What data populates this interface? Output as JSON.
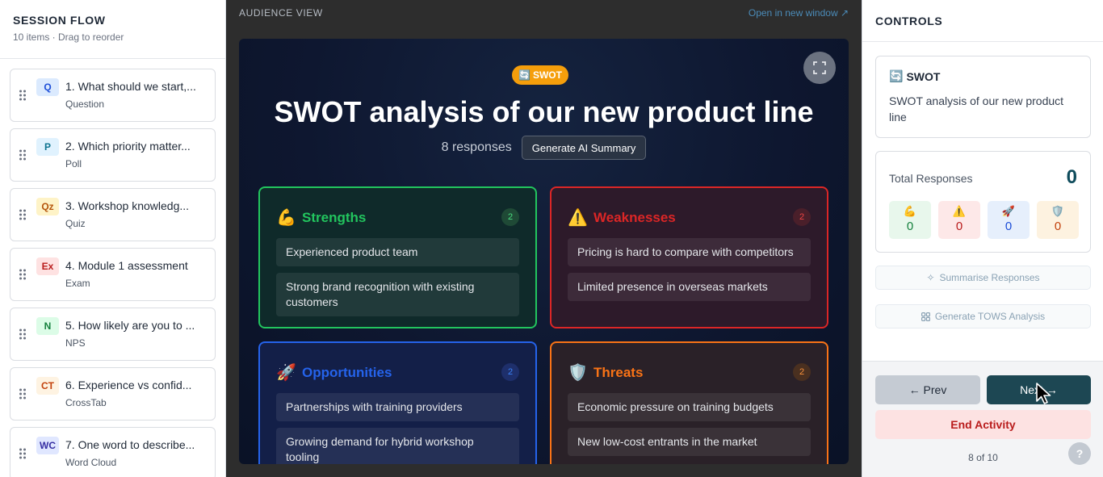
{
  "left": {
    "title": "SESSION FLOW",
    "subtitle": "10 items · Drag to reorder",
    "items": [
      {
        "badge": "Q",
        "title": "1. What should we start,...",
        "type": "Question",
        "badge_bg": "#dbeafe",
        "badge_fg": "#1d4ed8"
      },
      {
        "badge": "P",
        "title": "2. Which priority matter...",
        "type": "Poll",
        "badge_bg": "#e0f2fe",
        "badge_fg": "#0e7490"
      },
      {
        "badge": "Qz",
        "title": "3. Workshop knowledg...",
        "type": "Quiz",
        "badge_bg": "#fef3c7",
        "badge_fg": "#b45309"
      },
      {
        "badge": "Ex",
        "title": "4. Module 1 assessment",
        "type": "Exam",
        "badge_bg": "#fee2e2",
        "badge_fg": "#b91c1c"
      },
      {
        "badge": "N",
        "title": "5. How likely are you to ...",
        "type": "NPS",
        "badge_bg": "#dcfce7",
        "badge_fg": "#15803d"
      },
      {
        "badge": "CT",
        "title": "6. Experience vs confid...",
        "type": "CrossTab",
        "badge_bg": "#fef3e2",
        "badge_fg": "#c2410c"
      },
      {
        "badge": "WC",
        "title": "7. One word to describe...",
        "type": "Word Cloud",
        "badge_bg": "#e0e7ff",
        "badge_fg": "#3730a3"
      }
    ]
  },
  "center": {
    "label": "AUDIENCE VIEW",
    "open_link": "Open in new window ↗",
    "pill": "SWOT",
    "title": "SWOT analysis of our new product line",
    "responses": "8 responses",
    "ai_button": "Generate AI Summary",
    "quadrants": {
      "strengths": {
        "label": "Strengths",
        "count": "2",
        "items": [
          "Experienced product team",
          "Strong brand recognition with existing customers"
        ]
      },
      "weaknesses": {
        "label": "Weaknesses",
        "count": "2",
        "items": [
          "Pricing is hard to compare with competitors",
          "Limited presence in overseas markets"
        ]
      },
      "opportunities": {
        "label": "Opportunities",
        "count": "2",
        "items": [
          "Partnerships with training providers",
          "Growing demand for hybrid workshop tooling"
        ]
      },
      "threats": {
        "label": "Threats",
        "count": "2",
        "items": [
          "Economic pressure on training budgets",
          "New low-cost entrants in the market"
        ]
      }
    }
  },
  "right": {
    "title": "CONTROLS",
    "card_label": "SWOT",
    "card_text": "SWOT analysis of our new product line",
    "total_label": "Total Responses",
    "total_value": "0",
    "mini": {
      "strengths": "0",
      "weaknesses": "0",
      "opportunities": "0",
      "threats": "0"
    },
    "summarise": "Summarise Responses",
    "tows": "Generate TOWS Analysis",
    "prev": "← Prev",
    "next": "Next →",
    "end": "End Activity",
    "pager": "8 of 10",
    "help": "?"
  },
  "colors": {
    "strengths": "#22c55e",
    "weaknesses": "#dc2626",
    "opportunities": "#2563eb",
    "threats": "#f97316",
    "accent": "#1d4753"
  },
  "icons": {
    "drag": "drag-handle-icon",
    "fullscreen": "fullscreen-icon",
    "swot": "swot-icon",
    "strengths": "flexed-biceps-icon",
    "weaknesses": "warning-icon",
    "opportunities": "rocket-icon",
    "threats": "shield-icon",
    "sparkle": "sparkle-icon",
    "grid": "grid-icon"
  }
}
